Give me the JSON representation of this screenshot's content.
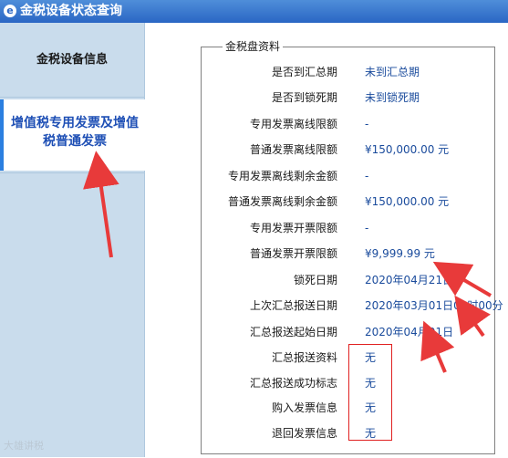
{
  "window": {
    "title": "金税设备状态查询",
    "icon": "app-logo-icon"
  },
  "sidebar": {
    "tabs": [
      {
        "label": "金税设备信息"
      },
      {
        "label": "增值税专用发票及增值税普通发票"
      }
    ]
  },
  "group": {
    "legend": "金税盘资料",
    "rows": [
      {
        "label": "是否到汇总期",
        "value": "未到汇总期"
      },
      {
        "label": "是否到锁死期",
        "value": "未到锁死期"
      },
      {
        "label": "专用发票离线限额",
        "value": "-"
      },
      {
        "label": "普通发票离线限额",
        "value": "¥150,000.00 元"
      },
      {
        "label": "专用发票离线剩余金额",
        "value": "-"
      },
      {
        "label": "普通发票离线剩余金额",
        "value": "¥150,000.00 元"
      },
      {
        "label": "专用发票开票限额",
        "value": "-"
      },
      {
        "label": "普通发票开票限额",
        "value": "¥9,999.99 元"
      },
      {
        "label": "锁死日期",
        "value": "2020年04月21日"
      },
      {
        "label": "上次汇总报送日期",
        "value": "2020年03月01日00时00分"
      },
      {
        "label": "汇总报送起始日期",
        "value": "2020年04月01日"
      },
      {
        "label": "汇总报送资料",
        "value": "无"
      },
      {
        "label": "汇总报送成功标志",
        "value": "无"
      },
      {
        "label": "购入发票信息",
        "value": "无"
      },
      {
        "label": "退回发票信息",
        "value": "无"
      }
    ]
  },
  "watermark": {
    "text": "大雄讲税"
  },
  "colors": {
    "titlebar": "#2a66c4",
    "sidebar": "#c9dcec",
    "value_text": "#1a4b9c",
    "annotation": "#e83a3a",
    "tab_accent": "#2b7fe0"
  }
}
